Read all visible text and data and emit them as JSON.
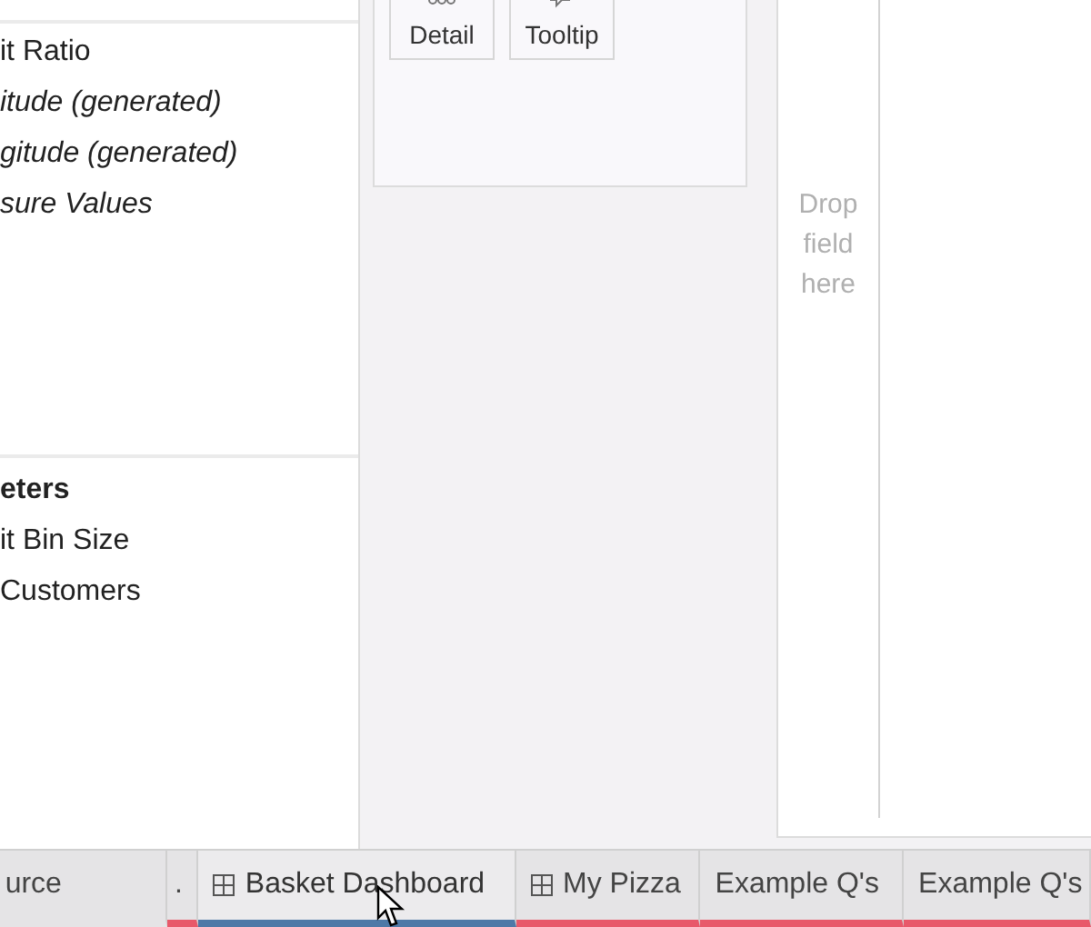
{
  "data_pane": {
    "fields": [
      {
        "label": "it Ratio",
        "kind": "field"
      },
      {
        "label": "itude (generated)",
        "kind": "measure"
      },
      {
        "label": "gitude (generated)",
        "kind": "measure"
      },
      {
        "label": "sure Values",
        "kind": "measure"
      }
    ],
    "parameters": {
      "title": "eters",
      "items": [
        {
          "label": "it Bin Size"
        },
        {
          "label": "Customers"
        }
      ]
    }
  },
  "marks_card": {
    "buttons": [
      {
        "label": "Detail",
        "kind": "detail"
      },
      {
        "label": "Tooltip",
        "kind": "tooltip"
      }
    ]
  },
  "canvas": {
    "drop_hint": "Drop field here"
  },
  "sheet_tabs": [
    {
      "label": "urce",
      "kind": "source",
      "selected": false
    },
    {
      "label": ".",
      "kind": "sheet",
      "selected": false,
      "color": "#e8596a"
    },
    {
      "label": "Basket Dashboard",
      "kind": "dashboard",
      "selected": true,
      "color": "#4e79a7"
    },
    {
      "label": "My Pizza",
      "kind": "dashboard",
      "selected": false,
      "color": "#e8596a"
    },
    {
      "label": "Example Q's",
      "kind": "sheet",
      "selected": false,
      "color": "#e8596a"
    },
    {
      "label": "Example Q's",
      "kind": "sheet",
      "selected": false,
      "color": "#e8596a"
    }
  ]
}
